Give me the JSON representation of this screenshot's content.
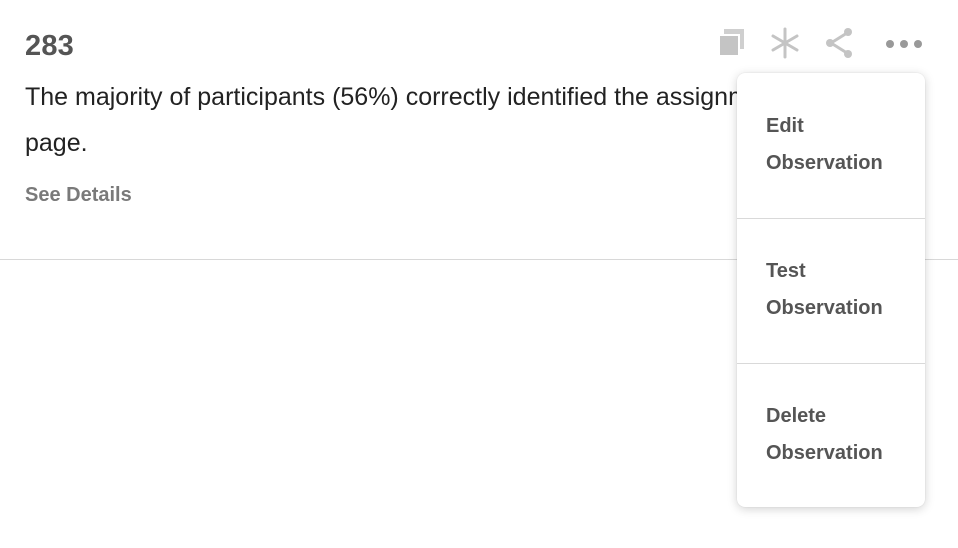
{
  "observation": {
    "number": "283",
    "text": "The majority of participants (56%) correctly identified the assignment on this page.",
    "details_link": "See Details"
  },
  "toolbar": {
    "icons": [
      "copy-icon",
      "asterisk-icon",
      "share-icon",
      "more-icon"
    ]
  },
  "menu": {
    "items": [
      {
        "label": "Edit Observation"
      },
      {
        "label": "Test Observation"
      },
      {
        "label": "Delete Observation"
      }
    ]
  },
  "colors": {
    "heading": "#555555",
    "body_text": "#222222",
    "muted_link": "#7a7a7a",
    "icon": "#c4c4c4",
    "divider": "#d9d9d9"
  }
}
